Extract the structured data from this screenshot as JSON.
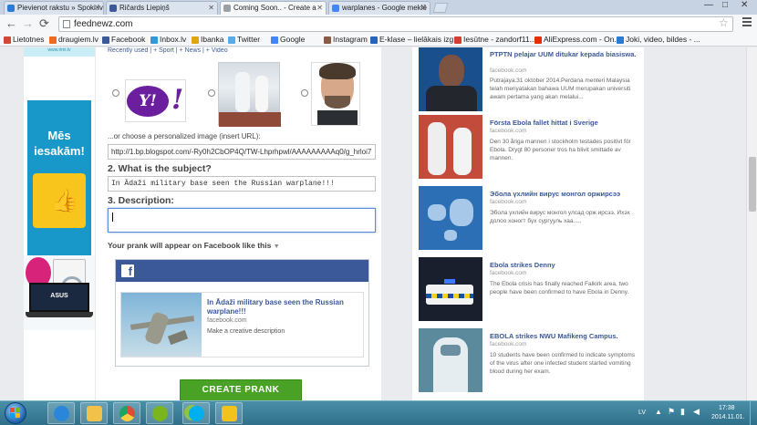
{
  "browser": {
    "tabs": [
      {
        "label": "Pievienot rakstu » Spoki.lv",
        "active": false,
        "color": "#2b7bd6"
      },
      {
        "label": "Ričards Liepiņš",
        "active": false,
        "color": "#3b5998"
      },
      {
        "label": "Coming Soon.. - Create a",
        "active": true,
        "color": "#7a7a7a"
      },
      {
        "label": "warplanes - Google meklē",
        "active": false,
        "color": "#4285f4"
      }
    ],
    "url": "feednewz.com",
    "bookmarks": [
      {
        "label": "Lietotnes",
        "color": "#d14836"
      },
      {
        "label": "draugiem.lv",
        "color": "#ef6a1f"
      },
      {
        "label": "Facebook",
        "color": "#3b5998"
      },
      {
        "label": "Inbox.lv",
        "color": "#2f9ad8"
      },
      {
        "label": "Ibanka",
        "color": "#e4a311"
      },
      {
        "label": "Twitter",
        "color": "#55acee"
      },
      {
        "label": "Google",
        "color": "#4285f4"
      },
      {
        "label": "Instagram",
        "color": "#8a5a44"
      },
      {
        "label": "E-klase – lielākais izg...",
        "color": "#2b64b3"
      },
      {
        "label": "Iesūtne - zandorf11...",
        "color": "#d23f31"
      },
      {
        "label": "AliExpress.com - On...",
        "color": "#e62e04"
      },
      {
        "label": "Joki, video, bildes - ...",
        "color": "#2b7bd6"
      }
    ]
  },
  "ads": {
    "top_text": "www.rimi.lv",
    "blue_text": "Mēs iesakām!",
    "laptop_brand": "ASUS"
  },
  "form": {
    "image_tabs": "Recently used  |  + Sport  |  + News  |  + Video",
    "image_options": [
      {
        "name": "Yahoo logo",
        "text": "Y!",
        "selected": false
      },
      {
        "name": "Ebola workers",
        "selected": false
      },
      {
        "name": "Man portrait",
        "selected": false
      }
    ],
    "choose_label": "...or choose a personalized image (insert URL):",
    "image_url": "http://1.bp.blogspot.com/-Ry0h2CbOP4Q/TW-Lhprhpwl/AAAAAAAAAq0/g_hrloi7",
    "subject_label": "2. What is the subject?",
    "subject_value": "In Ādaži military base seen the Russian warplane!!!",
    "description_label": "3. Description:",
    "description_value": "",
    "appear_label": "Your prank will appear on Facebook like this",
    "preview": {
      "title": "In Ādaži military base seen the Russian warplane!!!",
      "domain": "facebook.com",
      "description": "Make a creative description"
    },
    "create_button": "CREATE PRANK"
  },
  "sidebar_news": [
    {
      "title": "PTPTN pelajar UUM ditukar kepada biasiswa.",
      "source": "facebook.com",
      "excerpt": "Putrajaya.31 oktober 2014.Perdana menteri Malaysia telah menyatakan bahawa UUM merupakan universiti awam pertama yang akan melalui..."
    },
    {
      "title": "Första Ebola fallet hittat i Sverige",
      "source": "facebook.com",
      "excerpt": "Den 30 åriga mannen i stockholm testades positivt för Ebola. Drygt 80 personer tros ha blivit smittade av mannen."
    },
    {
      "title": "Эбола үхлийн вирус монгол оржирсээ",
      "source": "facebook.com",
      "excerpt": "Эбола үхлийн вирус монгол улсад орж ирсээ. Ихэх долоо хоногт бүх сургууль хаа....."
    },
    {
      "title": "Ebola strikes Denny",
      "source": "facebook.com",
      "excerpt": "The Ebola crisis has finally reached Falkirk area, two people have been confirmed to have Ebola in Denny."
    },
    {
      "title": "EBOLA strikes NWU Mafikeng Campus.",
      "source": "facebook.com",
      "excerpt": "10 students have been confirmed to indicate symptoms of the virus after one infected student started vomiting blood during her exam."
    }
  ],
  "taskbar": {
    "apps": [
      {
        "name": "internet-explorer",
        "color": "#2a86d8"
      },
      {
        "name": "folder",
        "color": "#f2c14a"
      },
      {
        "name": "chrome",
        "color": "#dd4b39"
      },
      {
        "name": "utorrent",
        "color": "#7ab51d"
      },
      {
        "name": "utorrent-2",
        "color": "#7ab51d"
      },
      {
        "name": "skype",
        "color": "#00aff0"
      },
      {
        "name": "security-center",
        "color": "#f3c21b"
      }
    ],
    "lang": "LV",
    "time": "17:38",
    "date": "2014.11.01."
  },
  "colors": {
    "facebook_blue": "#3b5998",
    "create_green": "#49a125"
  }
}
